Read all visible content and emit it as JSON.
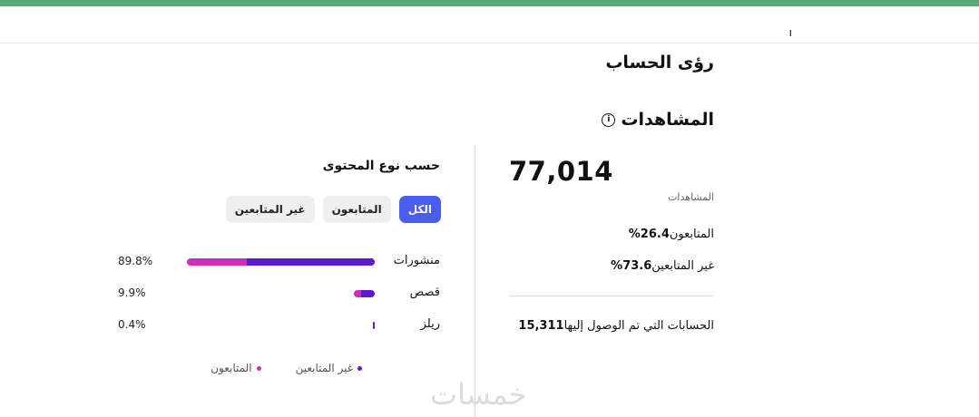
{
  "header": {
    "cut_text": "ـ ـ ا",
    "title": "رؤى الحساب"
  },
  "views": {
    "heading": "المشاهدات",
    "info_icon": "info-circle-icon",
    "total": "77,014",
    "total_label": "المشاهدات",
    "followers_label": "المتابعون",
    "followers_pct": "26.4%",
    "nonfollowers_label": "غير المتابعين",
    "nonfollowers_pct": "73.6%",
    "reached_label": "الحسابات التي تم الوصول إليها",
    "reached_value": "15,311"
  },
  "content_type": {
    "title": "حسب نوع المحتوى",
    "filters": [
      {
        "label": "الكل",
        "active": true
      },
      {
        "label": "المتابعون",
        "active": false
      },
      {
        "label": "غير المتابعين",
        "active": false
      }
    ],
    "rows": [
      {
        "label": "منشورات",
        "pct": "89.8%",
        "share": 0.898,
        "followers_share": 0.32
      },
      {
        "label": "قصص",
        "pct": "9.9%",
        "share": 0.099,
        "followers_share": 0.35
      },
      {
        "label": "ريلز",
        "pct": "0.4%",
        "share": 0.004,
        "followers_share": 0.0
      }
    ],
    "legend": {
      "followers": "المتابعون",
      "nonfollowers": "غير المتابعين"
    }
  },
  "colors": {
    "followers": "#cf2fb5",
    "nonfollowers": "#5b19d0",
    "accent": "#4b5cf0"
  },
  "watermark": "خمسات"
}
